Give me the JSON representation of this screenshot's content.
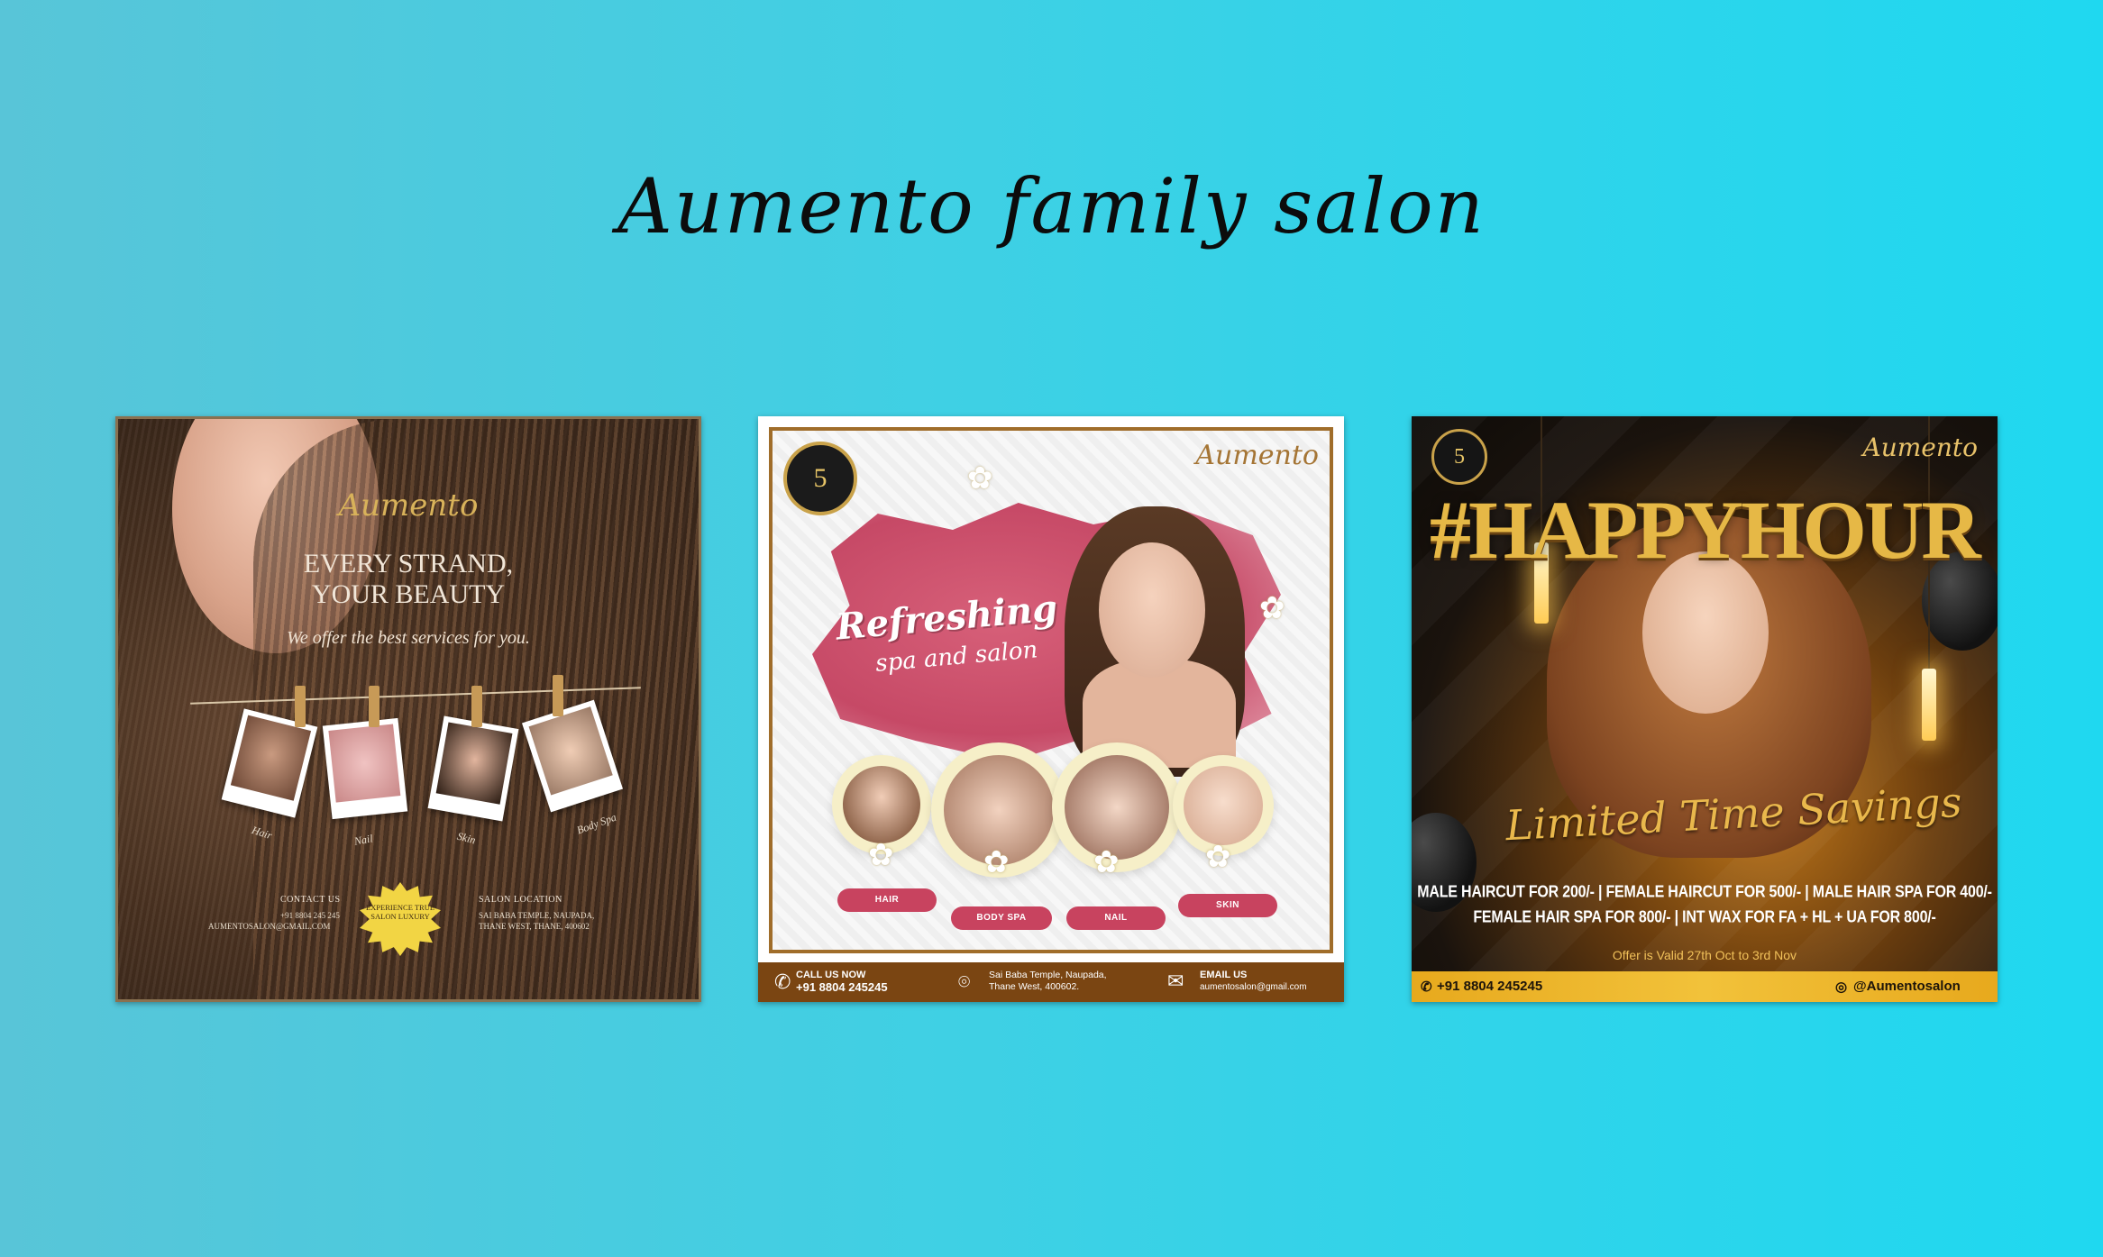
{
  "page": {
    "title": "Aumento family salon",
    "background_colors": [
      "#58c5d8",
      "#1fd8f0"
    ]
  },
  "card1": {
    "logo": "Aumento",
    "headline": "EVERY STRAND, YOUR BEAUTY",
    "subtitle": "We offer the best services for you.",
    "services": [
      "Hair",
      "Nail",
      "Skin",
      "Body Spa"
    ],
    "contact": {
      "heading": "CONTACT US",
      "phone": "+91 8804 245 245",
      "email": "AUMENTOSALON@GMAIL.COM"
    },
    "location": {
      "heading": "SALON LOCATION",
      "line1": "SAI BABA TEMPLE, NAUPADA,",
      "line2": "THANE WEST, THANE, 400602"
    },
    "badge": "EXPERIENCE TRUE SALON LUXURY",
    "colors": {
      "gold": "#d8b25a",
      "badge": "#f2d544"
    }
  },
  "card2": {
    "badge_number": "5",
    "logo": "Aumento",
    "title_line1": "Refreshing",
    "title_line2": "spa and salon",
    "services": [
      "HAIR",
      "BODY SPA",
      "NAIL",
      "SKIN"
    ],
    "footer": {
      "call_label": "CALL US NOW",
      "phone": "+91 8804 245245",
      "address_line1": "Sai Baba Temple, Naupada,",
      "address_line2": "Thane West, 400602.",
      "email_label": "EMAIL US",
      "email": "aumentosalon@gmail.com"
    },
    "colors": {
      "accent": "#c8435f",
      "footer": "#7a4512",
      "frame": "#a06d2a"
    }
  },
  "card3": {
    "badge_number": "5",
    "logo": "Aumento",
    "title": "#HAPPYHOUR",
    "script": "Limited Time Savings",
    "offers_line1": "MALE HAIRCUT FOR 200/- | FEMALE HAIRCUT FOR 500/- | MALE HAIR SPA FOR 400/-",
    "offers_line2": "FEMALE HAIR SPA FOR 800/- | INT WAX FOR FA + HL + UA FOR 800/-",
    "validity": "Offer is Valid 27th Oct to 3rd Nov",
    "footer_phone": "+91 8804 245245",
    "footer_instagram": "@Aumentosalon",
    "colors": {
      "gold": "#e6b846",
      "footer": "#f2c23a"
    }
  }
}
